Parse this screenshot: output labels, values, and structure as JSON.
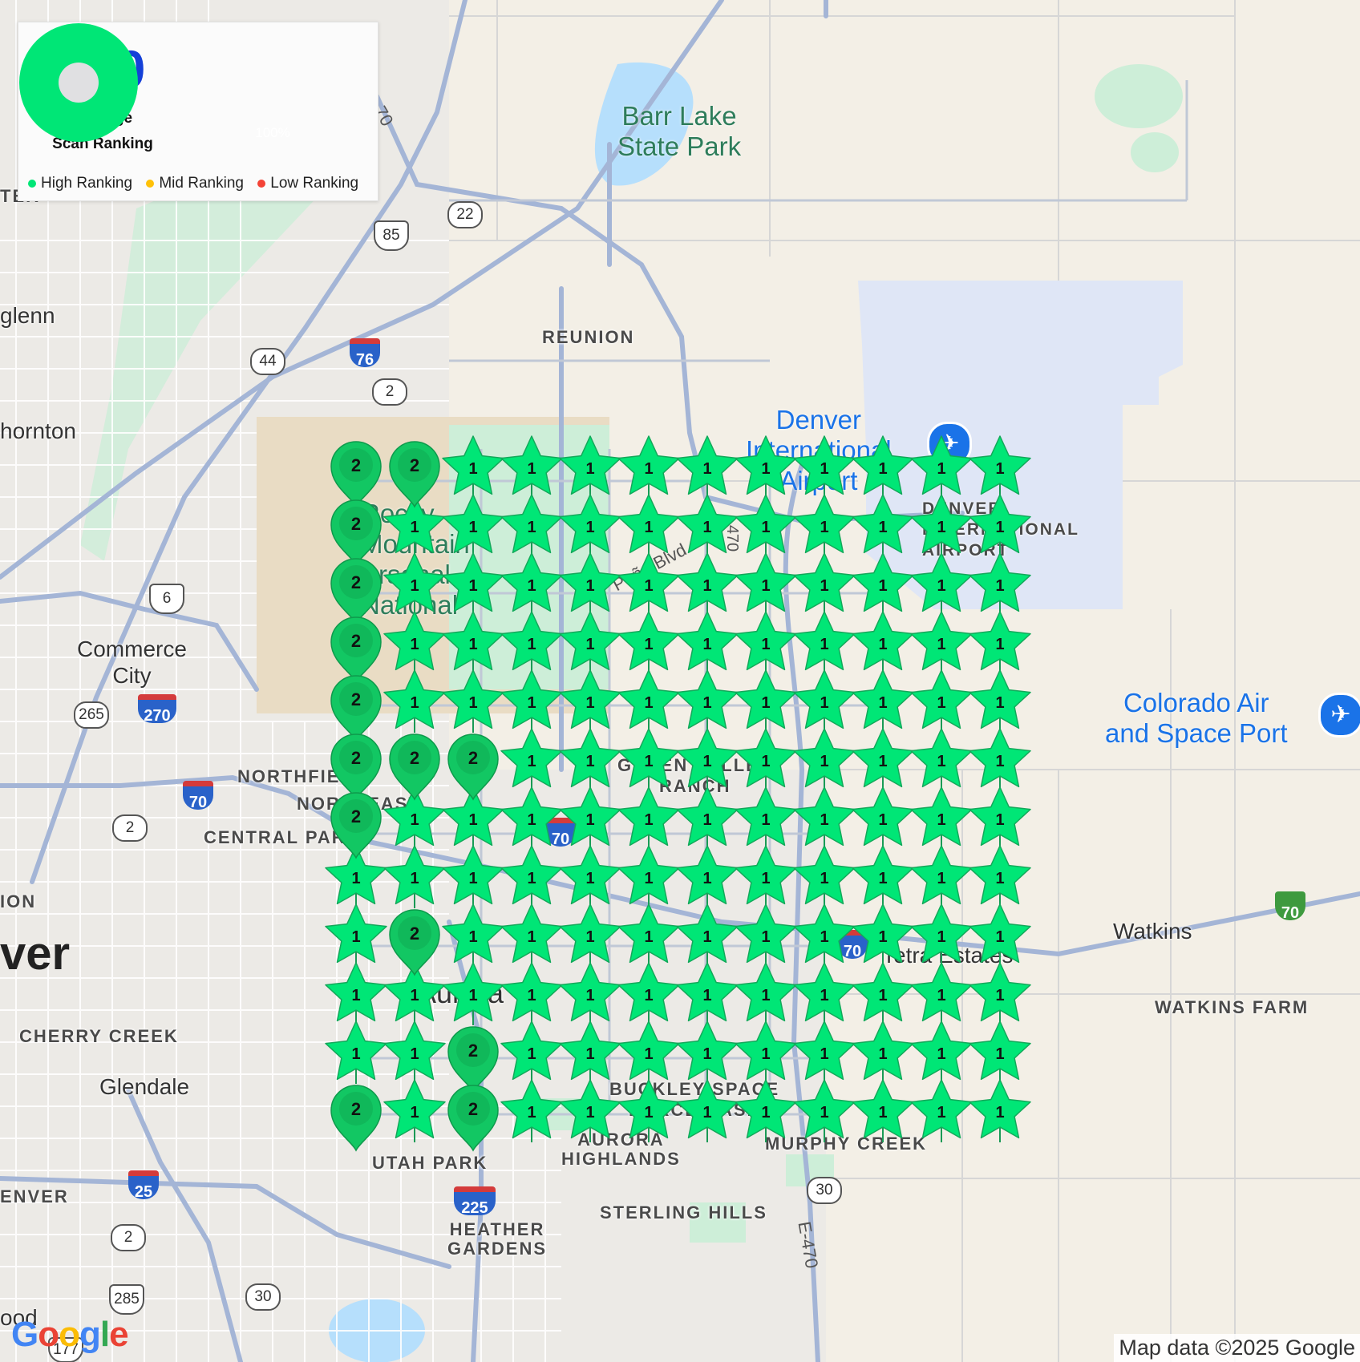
{
  "summary": {
    "average_value": "1.10",
    "average_label_line1": "Average",
    "average_label_line2": "Scan Ranking",
    "percent_label": "100%",
    "percent_value": 1.0,
    "donut_color": "#00e676",
    "donut_center_color": "#e0e0e2"
  },
  "legend": {
    "high": "High Ranking",
    "mid": "Mid Ranking",
    "low": "Low Ranking",
    "high_color": "#00e676",
    "mid_color": "#ffc107",
    "low_color": "#f44336"
  },
  "grid": {
    "marker_color": "#00e676",
    "rows": [
      [
        2,
        2,
        1,
        1,
        1,
        1,
        1,
        1,
        1,
        1,
        1,
        1
      ],
      [
        2,
        1,
        1,
        1,
        1,
        1,
        1,
        1,
        1,
        1,
        1,
        1
      ],
      [
        2,
        1,
        1,
        1,
        1,
        1,
        1,
        1,
        1,
        1,
        1,
        1
      ],
      [
        2,
        1,
        1,
        1,
        1,
        1,
        1,
        1,
        1,
        1,
        1,
        1
      ],
      [
        2,
        1,
        1,
        1,
        1,
        1,
        1,
        1,
        1,
        1,
        1,
        1
      ],
      [
        2,
        2,
        2,
        1,
        1,
        1,
        1,
        1,
        1,
        1,
        1,
        1
      ],
      [
        2,
        1,
        1,
        1,
        1,
        1,
        1,
        1,
        1,
        1,
        1,
        1
      ],
      [
        1,
        1,
        1,
        1,
        1,
        1,
        1,
        1,
        1,
        1,
        1,
        1
      ],
      [
        1,
        2,
        1,
        1,
        1,
        1,
        1,
        1,
        1,
        1,
        1,
        1
      ],
      [
        1,
        1,
        1,
        1,
        1,
        1,
        1,
        1,
        1,
        1,
        1,
        1
      ],
      [
        1,
        1,
        2,
        1,
        1,
        1,
        1,
        1,
        1,
        1,
        1,
        1
      ],
      [
        2,
        1,
        2,
        1,
        1,
        1,
        1,
        1,
        1,
        1,
        1,
        1
      ]
    ]
  },
  "map_labels": {
    "barr_lake": "Barr Lake\nState Park",
    "reunion": "REUNION",
    "northglenn": "glenn",
    "thornton": "hornton",
    "denver_airport": "Denver\nInternational\nAirport",
    "denver_airport_caps": "DENVER\nINTERNATIONAL\nAIRPORT",
    "rocky_mountain": "Rocky\nMountain\nArsenal\nNational",
    "pena_blvd": "Peña Blvd",
    "commerce_city": "Commerce\nCity",
    "northfield": "NORTHFIELD",
    "northeast": "NORTHEAST",
    "central_park": "CENTRAL PARK",
    "green_valley": "GREEN VALLEY\nRANCH",
    "colorado_air": "Colorado Air\nand Space Port",
    "watkins": "Watkins",
    "watkins_farm": "WATKINS FARM",
    "tetra_estates": "Tetra Estates",
    "denver_big": "ver",
    "ion": "ION",
    "cherry_creek": "CHERRY CREEK",
    "glendale": "Glendale",
    "aurora": "Aurora",
    "buckley": "BUCKLEY SPACE\nFORCE BASE",
    "aurora_highlands": "AURORA\nHIGHLANDS",
    "murphy_creek": "MURPHY CREEK",
    "utah_park": "UTAH PARK",
    "denver_caps": "ENVER",
    "sterling_hills": "STERLING HILLS",
    "heather_gardens": "HEATHER\nGARDENS",
    "e470": "E-470",
    "left_fragment": "TER",
    "wood_fragment": "ood",
    "highway_470": "470"
  },
  "shields": {
    "s70a": "70",
    "s22": "22",
    "s85": "85",
    "s76": "76",
    "s44": "44",
    "s2a": "2",
    "s6": "6",
    "s265": "265",
    "s270": "270",
    "s70b": "70",
    "s2b": "2",
    "s70c": "70",
    "s70d": "70",
    "s70e": "70",
    "s25": "25",
    "s225": "225",
    "s2c": "2",
    "s285": "285",
    "s30a": "30",
    "s30b": "30",
    "s177": "177"
  },
  "attribution": "Map data ©2025 Google",
  "google_logo": [
    "G",
    "o",
    "o",
    "g",
    "l",
    "e"
  ]
}
